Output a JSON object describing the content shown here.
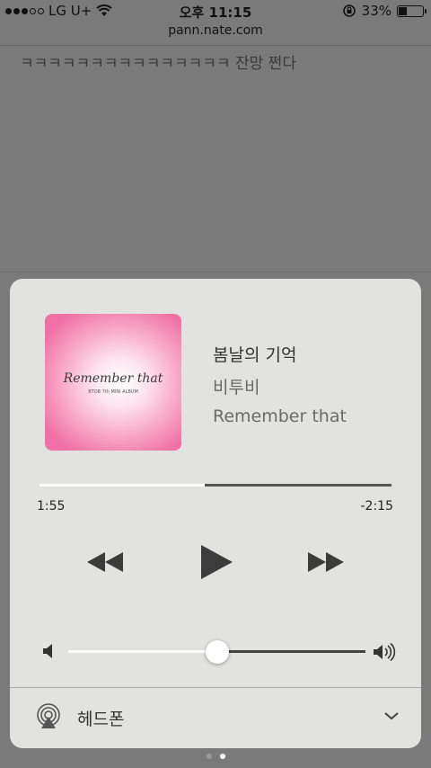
{
  "status_bar": {
    "carrier": "LG U+",
    "time": "오후 11:15",
    "battery": "33%"
  },
  "browser": {
    "url": "pann.nate.com",
    "content_text": "ㅋㅋㅋㅋㅋㅋㅋㅋㅋㅋㅋㅋㅋㅋㅋ 잔망 쩐다"
  },
  "now_playing": {
    "art_title": "Remember that",
    "art_subtitle": "BTOB 7th MINI ALBUM",
    "song": "봄날의 기억",
    "artist": "비투비",
    "album": "Remember that",
    "elapsed": "1:55",
    "remaining": "-2:15",
    "progress_fraction": 0.47,
    "volume_fraction": 0.5
  },
  "audio_route": {
    "label": "헤드폰"
  },
  "page_indicator": {
    "count": 2,
    "active": 1
  },
  "icons": {
    "rewind": "rewind-icon",
    "play": "play-icon",
    "forward": "fast-forward-icon",
    "airplay": "airplay-icon",
    "chevron": "chevron-down-icon"
  }
}
